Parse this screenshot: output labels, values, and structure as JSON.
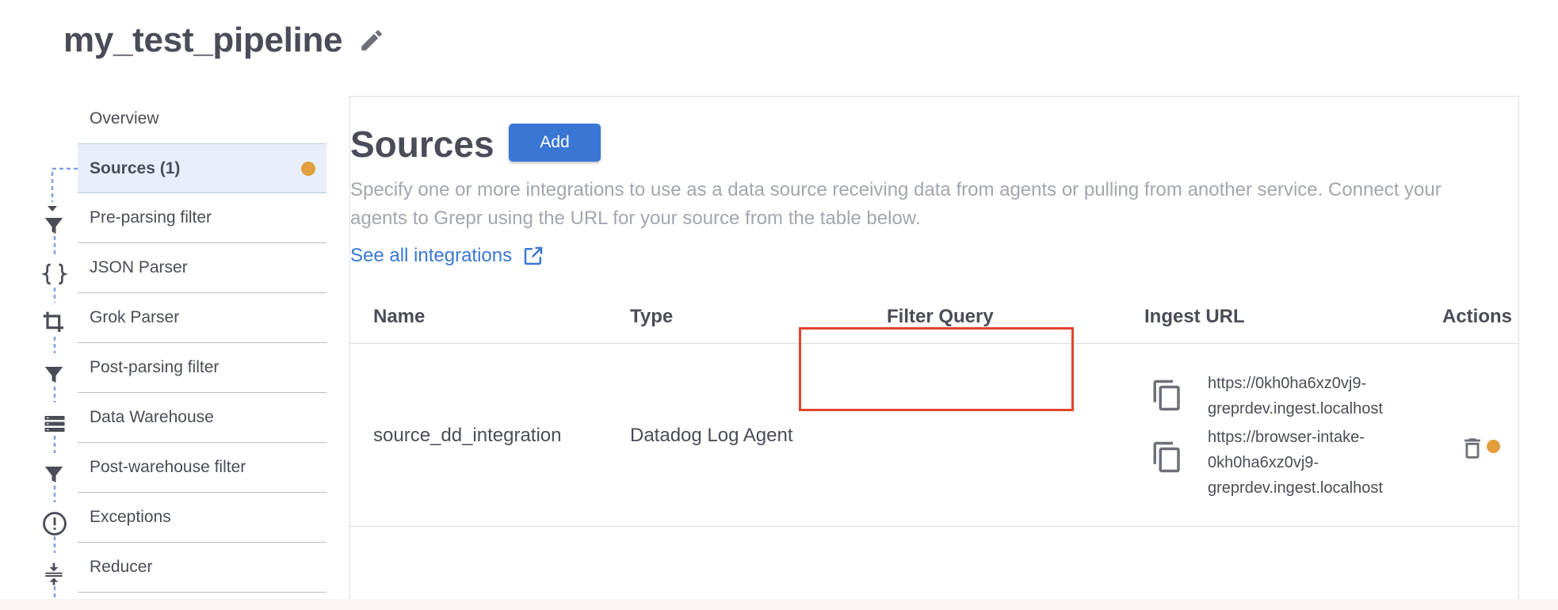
{
  "pipeline": {
    "title": "my_test_pipeline"
  },
  "steps": [
    {
      "label": "Overview",
      "icon": "none"
    },
    {
      "label": "Sources (1)",
      "icon": "none",
      "active": true,
      "status_color": "#e39f3c"
    },
    {
      "label": "Pre-parsing filter",
      "icon": "filter-icon"
    },
    {
      "label": "JSON Parser",
      "icon": "braces-icon"
    },
    {
      "label": "Grok Parser",
      "icon": "crop-icon"
    },
    {
      "label": "Post-parsing filter",
      "icon": "filter-icon"
    },
    {
      "label": "Data Warehouse",
      "icon": "storage-icon"
    },
    {
      "label": "Post-warehouse filter",
      "icon": "filter-icon"
    },
    {
      "label": "Exceptions",
      "icon": "alert-circle-icon"
    },
    {
      "label": "Reducer",
      "icon": "compress-icon"
    }
  ],
  "main": {
    "heading": "Sources",
    "add_label": "Add",
    "description": "Specify one or more integrations to use as a data source receiving data from agents or pulling from another service. Connect your agents to Grepr using the URL for your source from the table below.",
    "integrations_link": "See all integrations",
    "table": {
      "headers": [
        "Name",
        "Type",
        "Filter Query",
        "Ingest URL",
        "Actions"
      ],
      "rows": [
        {
          "name": "source_dd_integration",
          "type": "Datadog Log Agent",
          "filter_query": "",
          "urls": [
            {
              "line1": "https://0kh0ha6xz0vj9-",
              "line2": "greprdev.ingest.localhost",
              "line3": ""
            },
            {
              "line1": "https://browser-intake-",
              "line2": "0kh0ha6xz0vj9-",
              "line3": "greprdev.ingest.localhost"
            }
          ],
          "status_color": "#e39f3c"
        }
      ]
    }
  },
  "colors": {
    "accent": "#3a77d4",
    "status": "#e39f3c",
    "highlight": "#e2432c"
  }
}
